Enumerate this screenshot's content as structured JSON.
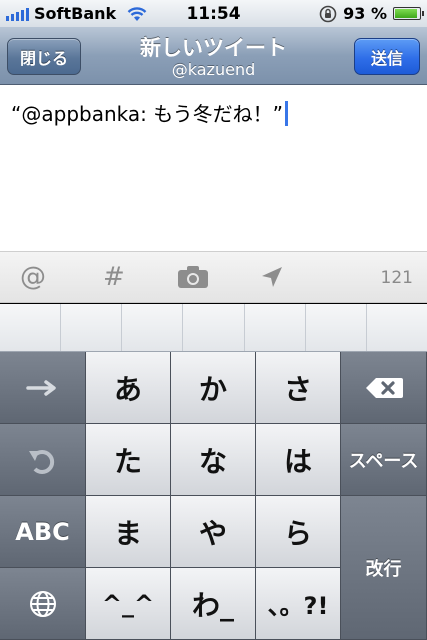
{
  "status_bar": {
    "carrier": "SoftBank",
    "time": "11:54",
    "battery": "93 %",
    "battery_level": 0.93
  },
  "nav": {
    "close_label": "閉じる",
    "title": "新しいツイート",
    "account": "@kazuend",
    "send_label": "送信"
  },
  "compose": {
    "text": "“@appbanka: もう冬だね！”"
  },
  "toolbar": {
    "mention": "@",
    "hashtag": "#",
    "char_count": "121"
  },
  "keyboard": {
    "rows": [
      [
        "あ",
        "か",
        "さ"
      ],
      [
        "た",
        "な",
        "は"
      ],
      [
        "ま",
        "や",
        "ら"
      ],
      [
        "^_^",
        "わ_",
        "、。?!"
      ]
    ],
    "abc": "ABC",
    "space": "スペース",
    "return": "改行"
  }
}
